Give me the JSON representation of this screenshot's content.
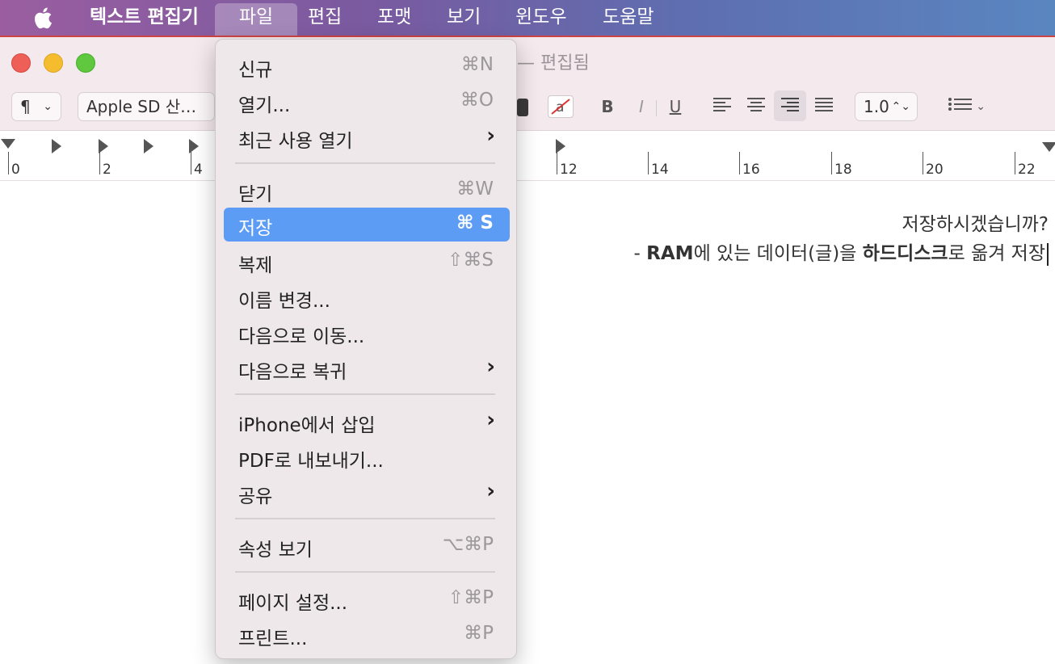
{
  "menubar": {
    "app_name": "텍스트 편집기",
    "items": [
      "파일",
      "편집",
      "포맷",
      "보기",
      "윈도우",
      "도움말"
    ]
  },
  "window": {
    "title": "— 편집됨",
    "toolbar": {
      "paragraph_style": "¶",
      "font": "Apple SD 산…",
      "line_spacing": "1.0",
      "bold": "B",
      "italic": "I",
      "underline": "U"
    },
    "ruler": {
      "labels": [
        "0",
        "2",
        "4",
        "12",
        "14",
        "16",
        "18",
        "20",
        "22"
      ]
    },
    "document": {
      "line1": "저장하시겠습니까?",
      "line2_prefix": "- ",
      "line2_bold1": "RAM",
      "line2_mid": "에 있는 데이터(글)을 ",
      "line2_bold2": "하드디스크",
      "line2_suffix": "로 옮겨 저장"
    }
  },
  "file_menu": {
    "items": [
      {
        "label": "신규",
        "shortcut": "⌘N"
      },
      {
        "label": "열기...",
        "shortcut": "⌘O"
      },
      {
        "label": "최근 사용 열기",
        "submenu": "›"
      },
      {
        "label": "닫기",
        "shortcut": "⌘W"
      },
      {
        "label": "저장",
        "shortcut": "⌘ S"
      },
      {
        "label": "복제",
        "shortcut": "⇧⌘S"
      },
      {
        "label": "이름 변경..."
      },
      {
        "label": "다음으로 이동..."
      },
      {
        "label": "다음으로 복귀",
        "submenu": "›"
      },
      {
        "label": "iPhone에서 삽입",
        "submenu": "›"
      },
      {
        "label": "PDF로 내보내기..."
      },
      {
        "label": "공유",
        "submenu": "›"
      },
      {
        "label": "속성 보기",
        "shortcut": "⌥⌘P"
      },
      {
        "label": "페이지 설정...",
        "shortcut": "⇧⌘P"
      },
      {
        "label": "프린트...",
        "shortcut": "⌘P"
      }
    ],
    "selected_index": 4
  },
  "colors": {
    "menu_highlight": "#5d9cf5",
    "window_chrome": "#f4e9ed"
  }
}
